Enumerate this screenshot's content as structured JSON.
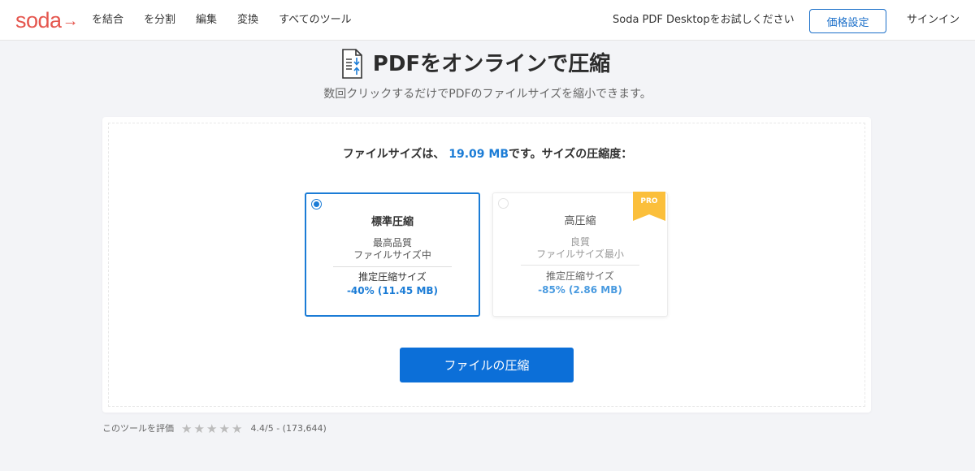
{
  "header": {
    "logo": "soda",
    "nav": [
      "を結合",
      "を分割",
      "編集",
      "変換",
      "すべてのツール"
    ],
    "trial": "Soda PDF Desktopをお試しください",
    "pricing": "価格設定",
    "signin": "サインイン"
  },
  "page": {
    "title": "PDFをオンラインで圧縮",
    "subtitle": "数回クリックするだけでPDFのファイルサイズを縮小できます。"
  },
  "file": {
    "prefix": "ファイルサイズは、",
    "size": "19.09 MB",
    "suffix": "です。サイズの圧縮度："
  },
  "options": [
    {
      "title": "標準圧縮",
      "line1": "最高品質",
      "line2": "ファイルサイズ中",
      "est_label": "推定圧縮サイズ",
      "est_value": "-40% (11.45 MB)",
      "selected": true
    },
    {
      "title": "高圧縮",
      "line1": "良質",
      "line2": "ファイルサイズ最小",
      "est_label": "推定圧縮サイズ",
      "est_value": "-85% (2.86 MB)",
      "selected": false,
      "badge": "PRO"
    }
  ],
  "compress_button": "ファイルの圧縮",
  "rating": {
    "label": "このツールを評価",
    "score": "4.4/5 - (173,644)",
    "stars": 5
  },
  "colors": {
    "brand": "#e5564e",
    "accent": "#1b7cd6",
    "button": "#0c6fd8",
    "pro_badge": "#fbbf3b"
  }
}
